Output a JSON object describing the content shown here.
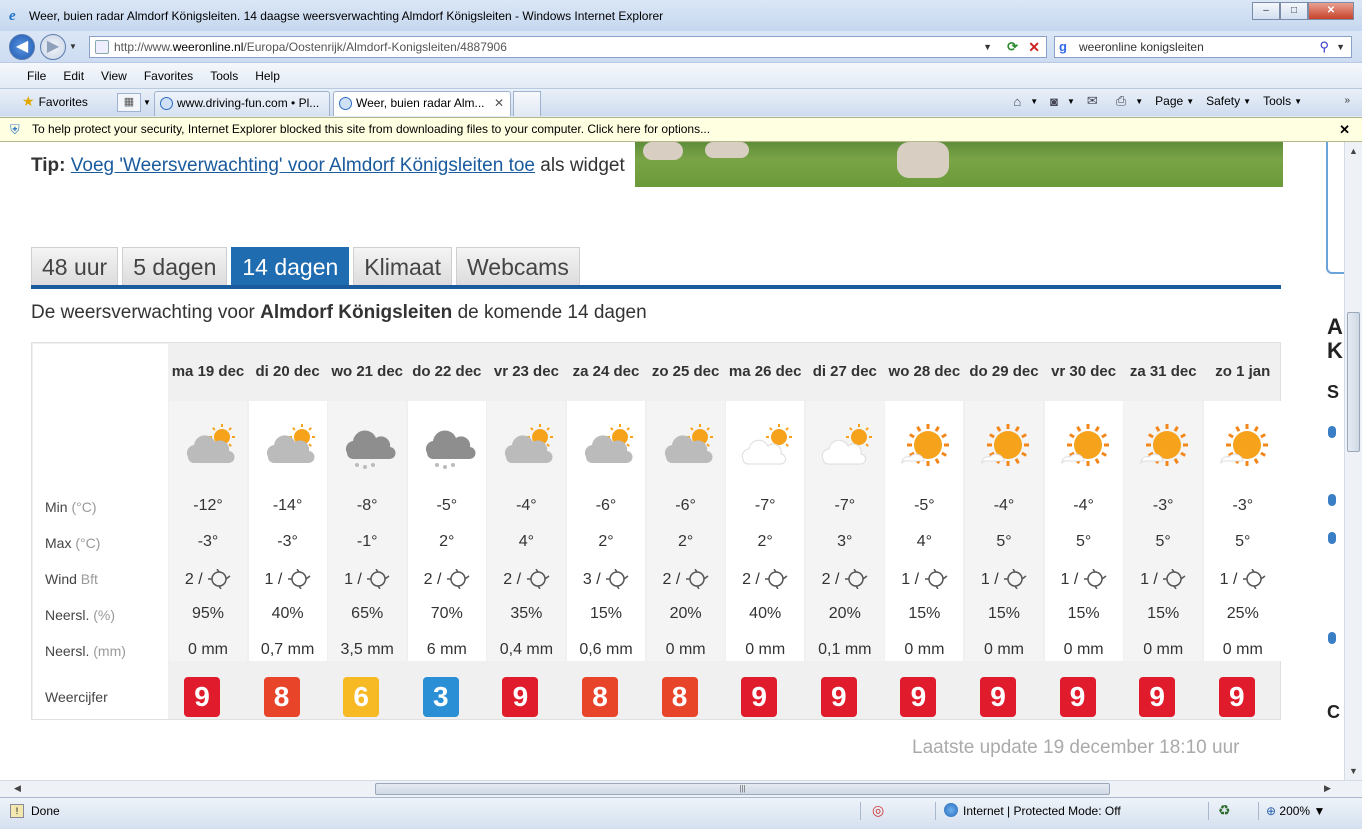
{
  "window": {
    "title": "Weer, buien radar Almdorf Königsleiten. 14 daagse weersverwachting Almdorf Königsleiten - Windows Internet Explorer",
    "buttons": {
      "minimize": "–",
      "maximize": "□",
      "close": "✕"
    }
  },
  "address": {
    "url_prefix": "http://www.",
    "url_host": "weeronline.nl",
    "url_path": "/Europa/Oostenrijk/Almdorf-Konigsleiten/4887906",
    "search_value": "weeronline konigsleiten"
  },
  "menu": [
    "File",
    "Edit",
    "View",
    "Favorites",
    "Tools",
    "Help"
  ],
  "favorites_label": "Favorites",
  "tabs": [
    {
      "label": "www.driving-fun.com • Pl..."
    },
    {
      "label": "Weer, buien radar Alm..."
    }
  ],
  "commands": {
    "page": "Page",
    "safety": "Safety",
    "tools": "Tools"
  },
  "infobar": "To help protect your security, Internet Explorer blocked this site from downloading files to your computer. Click here for options...",
  "tip": {
    "label": "Tip:",
    "link": "Voeg 'Weersverwachting' voor Almdorf Königsleiten toe",
    "suffix": "als widget"
  },
  "page_tabs": [
    "48 uur",
    "5 dagen",
    "14 dagen",
    "Klimaat",
    "Webcams"
  ],
  "active_tab_index": 2,
  "subtitle": {
    "prefix": "De weersverwachting voor",
    "place": "Almdorf Königsleiten",
    "suffix": "de komende 14 dagen"
  },
  "row_labels": {
    "min": {
      "label": "Min",
      "unit": "(°C)"
    },
    "max": {
      "label": "Max",
      "unit": "(°C)"
    },
    "wind": {
      "label": "Wind",
      "unit": "Bft"
    },
    "precip_pct": {
      "label": "Neersl.",
      "unit": "(%)"
    },
    "precip_mm": {
      "label": "Neersl.",
      "unit": "(mm)"
    },
    "score": {
      "label": "Weercijfer"
    }
  },
  "forecast": [
    {
      "day": "ma 19 dec",
      "icon": "partly-cloudy-icon",
      "min": "-12°",
      "max": "-3°",
      "wind": "2 /",
      "pct": "95%",
      "mm": "0 mm",
      "score": "9",
      "score_color": "#e01b2b"
    },
    {
      "day": "di 20 dec",
      "icon": "partly-cloudy-icon",
      "min": "-14°",
      "max": "-3°",
      "wind": "1 /",
      "pct": "40%",
      "mm": "0,7 mm",
      "score": "8",
      "score_color": "#e8442a"
    },
    {
      "day": "wo 21 dec",
      "icon": "snow-cloud-icon",
      "min": "-8°",
      "max": "-1°",
      "wind": "1 /",
      "pct": "65%",
      "mm": "3,5 mm",
      "score": "6",
      "score_color": "#f7b924"
    },
    {
      "day": "do 22 dec",
      "icon": "snow-cloud-icon",
      "min": "-5°",
      "max": "2°",
      "wind": "2 /",
      "pct": "70%",
      "mm": "6 mm",
      "score": "3",
      "score_color": "#2b8fd6"
    },
    {
      "day": "vr 23 dec",
      "icon": "partly-cloudy-icon",
      "min": "-4°",
      "max": "4°",
      "wind": "2 /",
      "pct": "35%",
      "mm": "0,4 mm",
      "score": "9",
      "score_color": "#e01b2b"
    },
    {
      "day": "za 24 dec",
      "icon": "partly-cloudy-icon",
      "min": "-6°",
      "max": "2°",
      "wind": "3 /",
      "pct": "15%",
      "mm": "0,6 mm",
      "score": "8",
      "score_color": "#e8442a"
    },
    {
      "day": "zo 25 dec",
      "icon": "partly-cloudy-icon",
      "min": "-6°",
      "max": "2°",
      "wind": "2 /",
      "pct": "20%",
      "mm": "0 mm",
      "score": "8",
      "score_color": "#e8442a"
    },
    {
      "day": "ma 26 dec",
      "icon": "sun-cloud-icon",
      "min": "-7°",
      "max": "2°",
      "wind": "2 /",
      "pct": "40%",
      "mm": "0 mm",
      "score": "9",
      "score_color": "#e01b2b"
    },
    {
      "day": "di 27 dec",
      "icon": "sun-cloud-icon",
      "min": "-7°",
      "max": "3°",
      "wind": "2 /",
      "pct": "20%",
      "mm": "0,1 mm",
      "score": "9",
      "score_color": "#e01b2b"
    },
    {
      "day": "wo 28 dec",
      "icon": "sunny-icon",
      "min": "-5°",
      "max": "4°",
      "wind": "1 /",
      "pct": "15%",
      "mm": "0 mm",
      "score": "9",
      "score_color": "#e01b2b"
    },
    {
      "day": "do 29 dec",
      "icon": "sunny-icon",
      "min": "-4°",
      "max": "5°",
      "wind": "1 /",
      "pct": "15%",
      "mm": "0 mm",
      "score": "9",
      "score_color": "#e01b2b"
    },
    {
      "day": "vr 30 dec",
      "icon": "sunny-icon",
      "min": "-4°",
      "max": "5°",
      "wind": "1 /",
      "pct": "15%",
      "mm": "0 mm",
      "score": "9",
      "score_color": "#e01b2b"
    },
    {
      "day": "za 31 dec",
      "icon": "sunny-icon",
      "min": "-3°",
      "max": "5°",
      "wind": "1 /",
      "pct": "15%",
      "mm": "0 mm",
      "score": "9",
      "score_color": "#e01b2b"
    },
    {
      "day": "zo 1 jan",
      "icon": "sunny-icon",
      "min": "-3°",
      "max": "5°",
      "wind": "1 /",
      "pct": "25%",
      "mm": "0 mm",
      "score": "9",
      "score_color": "#e01b2b"
    }
  ],
  "last_update": "Laatste update 19 december 18:10 uur",
  "status": {
    "done": "Done",
    "zone": "Internet | Protected Mode: Off",
    "zoom": "200%"
  }
}
